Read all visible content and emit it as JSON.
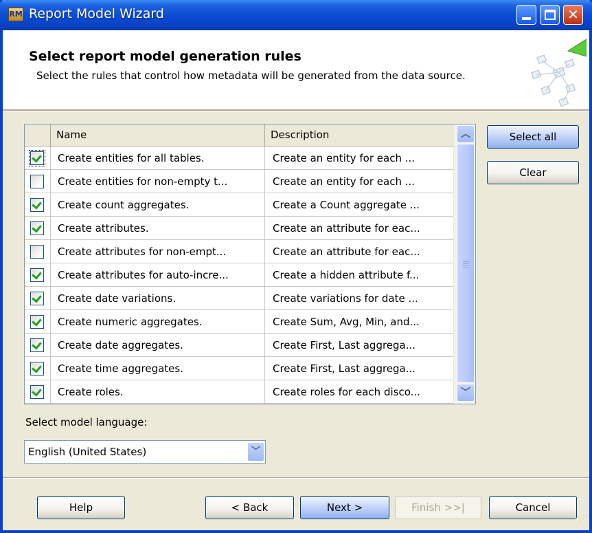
{
  "window": {
    "title": "Report Model Wizard",
    "app_icon_text": "RM"
  },
  "title_buttons": {
    "close_glyph": "✕"
  },
  "header": {
    "title": "Select report model generation rules",
    "subtitle": "Select the rules that control how metadata will be generated from the data source."
  },
  "grid": {
    "columns": [
      "Name",
      "Description"
    ],
    "rows": [
      {
        "checked": true,
        "name": "Create entities for all tables.",
        "description": "Create an entity for each ..."
      },
      {
        "checked": false,
        "name": "Create entities for non-empty t...",
        "description": "Create an entity for each ..."
      },
      {
        "checked": true,
        "name": "Create count aggregates.",
        "description": "Create a Count aggregate ..."
      },
      {
        "checked": true,
        "name": "Create attributes.",
        "description": "Create an attribute for eac..."
      },
      {
        "checked": false,
        "name": "Create attributes for non-empt...",
        "description": "Create an attribute for eac..."
      },
      {
        "checked": true,
        "name": "Create attributes for auto-incre...",
        "description": "Create a hidden attribute f..."
      },
      {
        "checked": true,
        "name": "Create date variations.",
        "description": "Create variations for date ..."
      },
      {
        "checked": true,
        "name": "Create numeric aggregates.",
        "description": "Create Sum, Avg, Min, and..."
      },
      {
        "checked": true,
        "name": "Create date aggregates.",
        "description": "Create First, Last aggrega..."
      },
      {
        "checked": true,
        "name": "Create time aggregates.",
        "description": "Create First, Last aggrega..."
      },
      {
        "checked": true,
        "name": "Create roles.",
        "description": "Create roles for each disco..."
      }
    ]
  },
  "side_buttons": {
    "select_all": "Select all",
    "clear": "Clear"
  },
  "language": {
    "label": "Select model language:",
    "selected": "English (United States)"
  },
  "footer": {
    "help": "Help",
    "back": "< Back",
    "next": "Next >",
    "finish": "Finish >>|",
    "cancel": "Cancel"
  },
  "colors": {
    "titlebar": "#0842c5",
    "window_bg": "#ece9d8",
    "checkmark": "#21a121"
  }
}
